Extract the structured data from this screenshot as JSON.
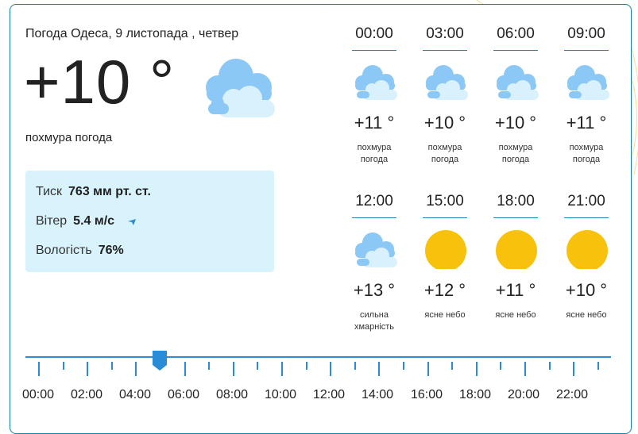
{
  "header": {
    "title": "Погода Одеса, 9 листопада , четвер"
  },
  "current": {
    "temperature": "+10 °",
    "condition": "похмура погода",
    "icon": "cloud-icon"
  },
  "details": {
    "pressure_label": "Тиск",
    "pressure_value": "763 мм рт. ст.",
    "wind_label": "Вітер",
    "wind_value": "5.4 м/с",
    "humidity_label": "Вологість",
    "humidity_value": "76%"
  },
  "forecast": [
    {
      "time": "00:00",
      "temp": "+11 °",
      "condition": "похмура погода",
      "icon": "cloud-icon"
    },
    {
      "time": "03:00",
      "temp": "+10 °",
      "condition": "похмура погода",
      "icon": "cloud-icon"
    },
    {
      "time": "06:00",
      "temp": "+10 °",
      "condition": "похмура погода",
      "icon": "cloud-icon"
    },
    {
      "time": "09:00",
      "temp": "+11 °",
      "condition": "похмура погода",
      "icon": "cloud-icon"
    },
    {
      "time": "12:00",
      "temp": "+13 °",
      "condition": "сильна хмарність",
      "icon": "cloud-icon"
    },
    {
      "time": "15:00",
      "temp": "+12 °",
      "condition": "ясне небо",
      "icon": "sun-icon"
    },
    {
      "time": "18:00",
      "temp": "+11 °",
      "condition": "ясне небо",
      "icon": "sun-icon"
    },
    {
      "time": "21:00",
      "temp": "+10 °",
      "condition": "ясне небо",
      "icon": "sun-icon"
    }
  ],
  "timeline": {
    "labels": [
      "00:00",
      "02:00",
      "04:00",
      "06:00",
      "08:00",
      "10:00",
      "12:00",
      "14:00",
      "16:00",
      "18:00",
      "20:00",
      "22:00"
    ],
    "selected_hour": 5
  },
  "colors": {
    "accent": "#2a8cd6",
    "sun": "#f7c10c",
    "cloud": "#8cc8f5",
    "info_bg": "#d9f3fc"
  }
}
